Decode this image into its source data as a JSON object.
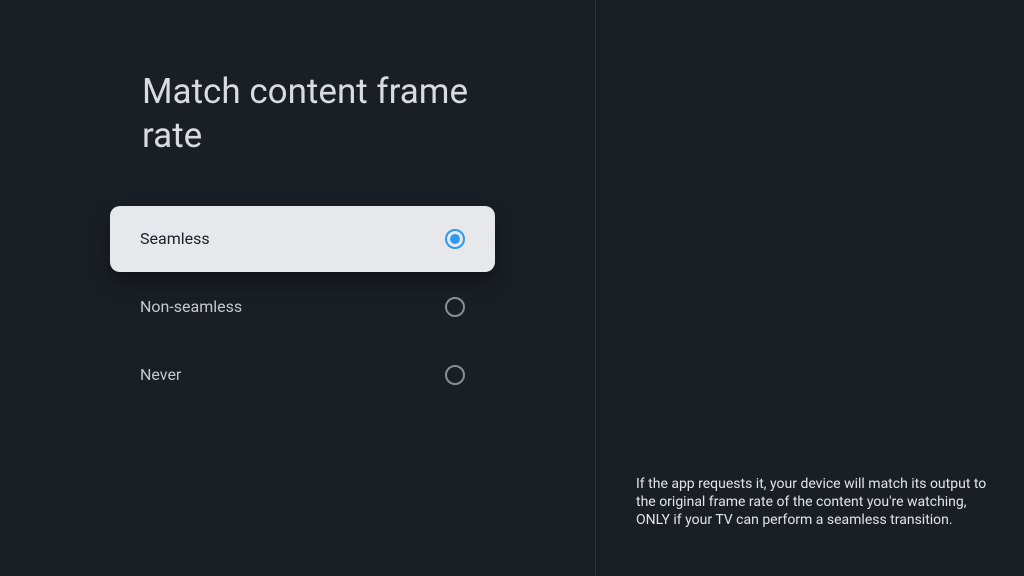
{
  "title": "Match content frame rate",
  "options": [
    {
      "label": "Seamless",
      "selected": true
    },
    {
      "label": "Non-seamless",
      "selected": false
    },
    {
      "label": "Never",
      "selected": false
    }
  ],
  "description": "If the app requests it, your device will match its output to the original frame rate of the content you're watching, ONLY if your TV can perform a seamless transition."
}
